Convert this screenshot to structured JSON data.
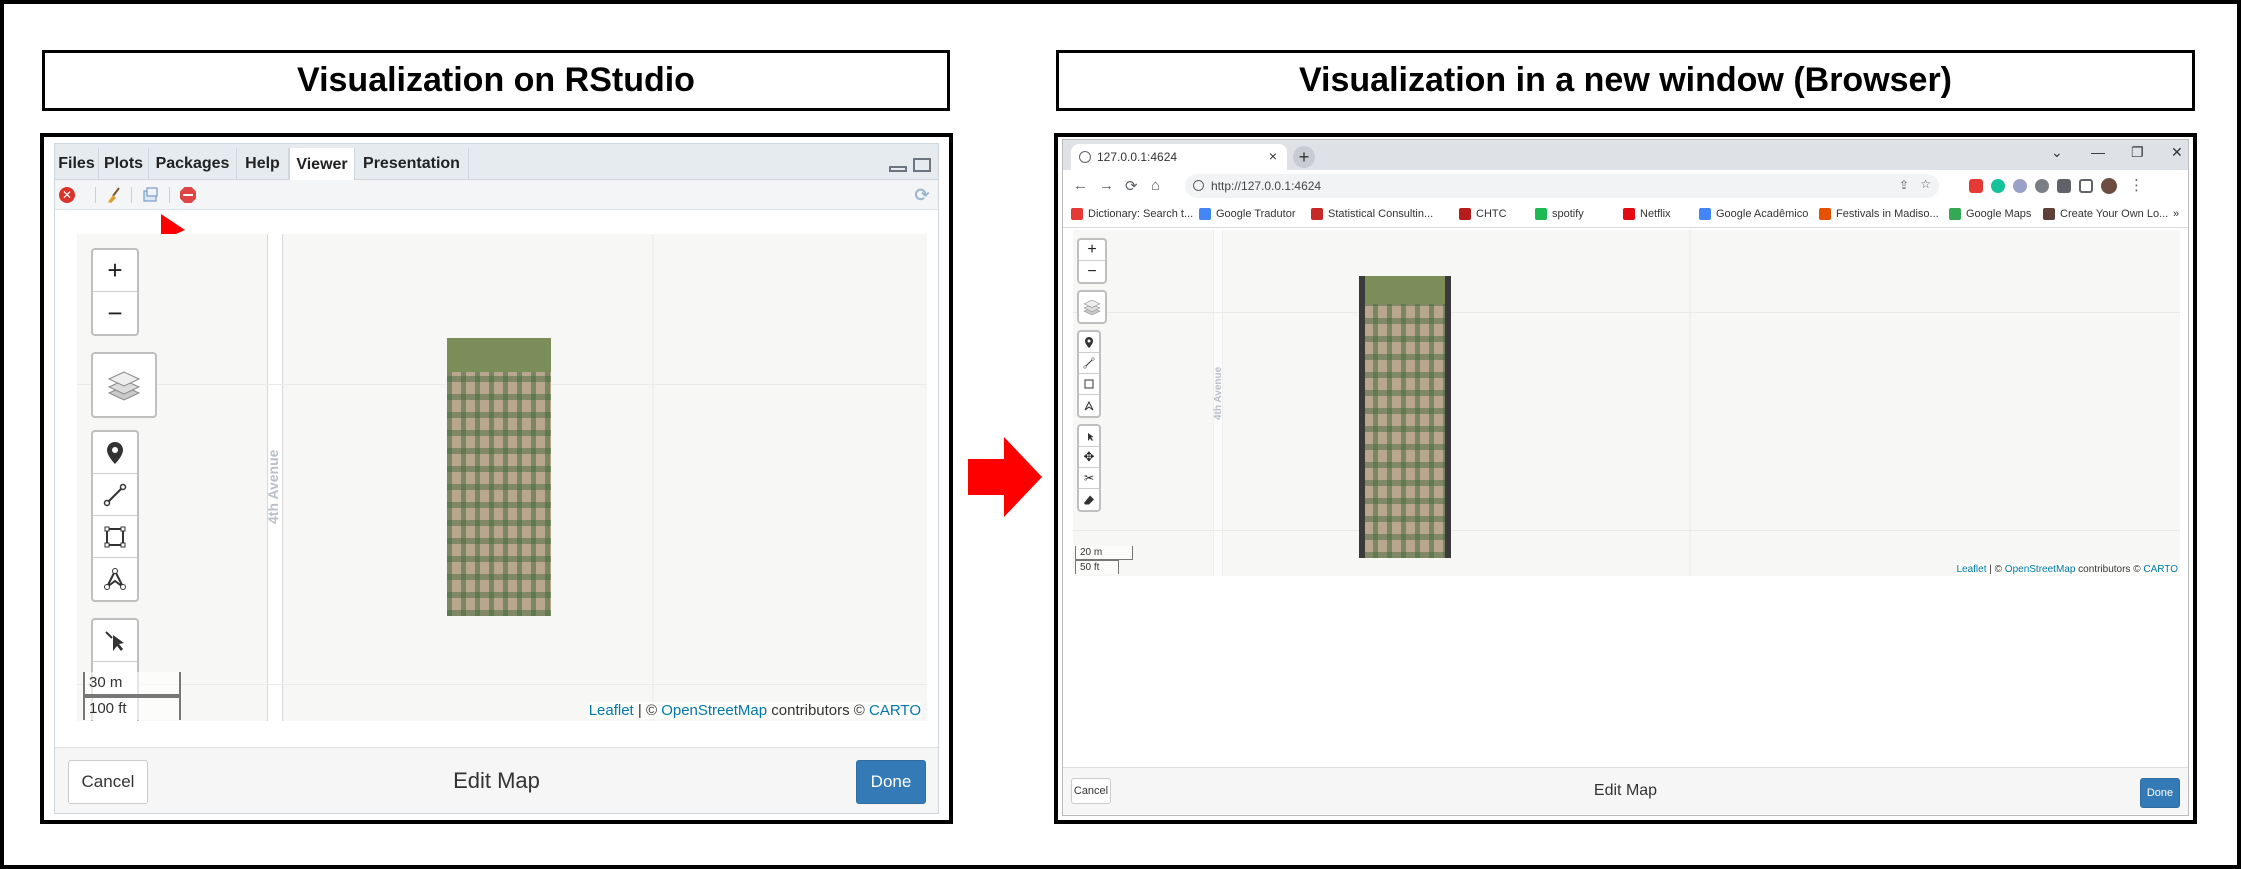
{
  "headings": {
    "left": "Visualization on RStudio",
    "right": "Visualization in a new window (Browser)"
  },
  "rstudio": {
    "tabs": [
      "Files",
      "Plots",
      "Packages",
      "Help",
      "Viewer",
      "Presentation"
    ],
    "active_tab": "Viewer",
    "map": {
      "street_label": "4th Avenue",
      "zoom_in": "+",
      "zoom_out": "−",
      "scale_metric": "30 m",
      "scale_imperial": "100 ft",
      "attribution": {
        "leaflet": "Leaflet",
        "sep": " | © ",
        "osm": "OpenStreetMap",
        "contributors": " contributors © ",
        "carto": "CARTO"
      }
    },
    "footer": {
      "cancel": "Cancel",
      "title": "Edit Map",
      "done": "Done"
    }
  },
  "browser": {
    "tab_title": "127.0.0.1:4624",
    "tab_close": "×",
    "new_tab": "+",
    "window_controls": [
      "⌄",
      "—",
      "❐",
      "✕"
    ],
    "url": "http://127.0.0.1:4624",
    "bookmarks": [
      {
        "label": "Dictionary: Search t...",
        "color": "#e53935"
      },
      {
        "label": "Google Tradutor",
        "color": "#4285f4"
      },
      {
        "label": "Statistical Consultin...",
        "color": "#c62828"
      },
      {
        "label": "CHTC",
        "color": "#b71c1c"
      },
      {
        "label": "spotify",
        "color": "#1db954"
      },
      {
        "label": "Netflix",
        "color": "#e50914"
      },
      {
        "label": "Google Acadêmico",
        "color": "#4285f4"
      },
      {
        "label": "Festivals in Madiso...",
        "color": "#e65100"
      },
      {
        "label": "Google Maps",
        "color": "#34a853"
      },
      {
        "label": "Create Your Own Lo...",
        "color": "#5d4037"
      }
    ],
    "bookmarks_more": "»",
    "map": {
      "street_label": "4th Avenue",
      "zoom_in": "+",
      "zoom_out": "−",
      "scale_metric": "20 m",
      "scale_imperial": "50 ft",
      "attribution": {
        "leaflet": "Leaflet",
        "sep": " | © ",
        "osm": "OpenStreetMap",
        "contributors": " contributors © ",
        "carto": "CARTO"
      }
    },
    "footer": {
      "cancel": "Cancel",
      "title": "Edit Map",
      "done": "Done"
    }
  },
  "colors": {
    "done_blue": "#337ab7",
    "arrow_red": "#ff0000",
    "link_blue": "#0078a8"
  }
}
